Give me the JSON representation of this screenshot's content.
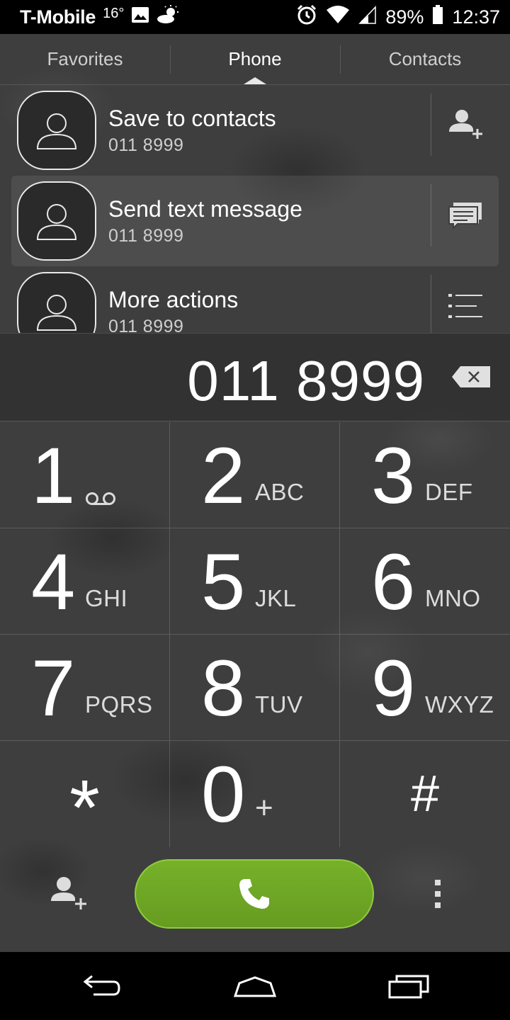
{
  "status_bar": {
    "carrier": "T-Mobile",
    "temperature": "16°",
    "battery": "89%",
    "time": "12:37",
    "icons": [
      "image-icon",
      "weather-icon",
      "alarm-icon",
      "wifi-icon",
      "signal-icon",
      "battery-icon"
    ]
  },
  "tabs": [
    {
      "label": "Favorites",
      "active": false
    },
    {
      "label": "Phone",
      "active": true
    },
    {
      "label": "Contacts",
      "active": false
    }
  ],
  "actions": [
    {
      "title": "Save to contacts",
      "number": "011 8999",
      "icon": "add-contact-icon"
    },
    {
      "title": "Send text message",
      "number": "011 8999",
      "icon": "message-icon"
    },
    {
      "title": "More actions",
      "number": "011 8999",
      "icon": "list-icon"
    }
  ],
  "dialed_number": "011 8999",
  "keypad": [
    {
      "digit": "1",
      "letters": "oo"
    },
    {
      "digit": "2",
      "letters": "ABC"
    },
    {
      "digit": "3",
      "letters": "DEF"
    },
    {
      "digit": "4",
      "letters": "GHI"
    },
    {
      "digit": "5",
      "letters": "JKL"
    },
    {
      "digit": "6",
      "letters": "MNO"
    },
    {
      "digit": "7",
      "letters": "PQRS"
    },
    {
      "digit": "8",
      "letters": "TUV"
    },
    {
      "digit": "9",
      "letters": "WXYZ"
    },
    {
      "digit": "*",
      "letters": ""
    },
    {
      "digit": "0",
      "letters": "+"
    },
    {
      "digit": "#",
      "letters": ""
    }
  ],
  "colors": {
    "call_green": "#6fa824",
    "background": "#3e3e3e"
  }
}
